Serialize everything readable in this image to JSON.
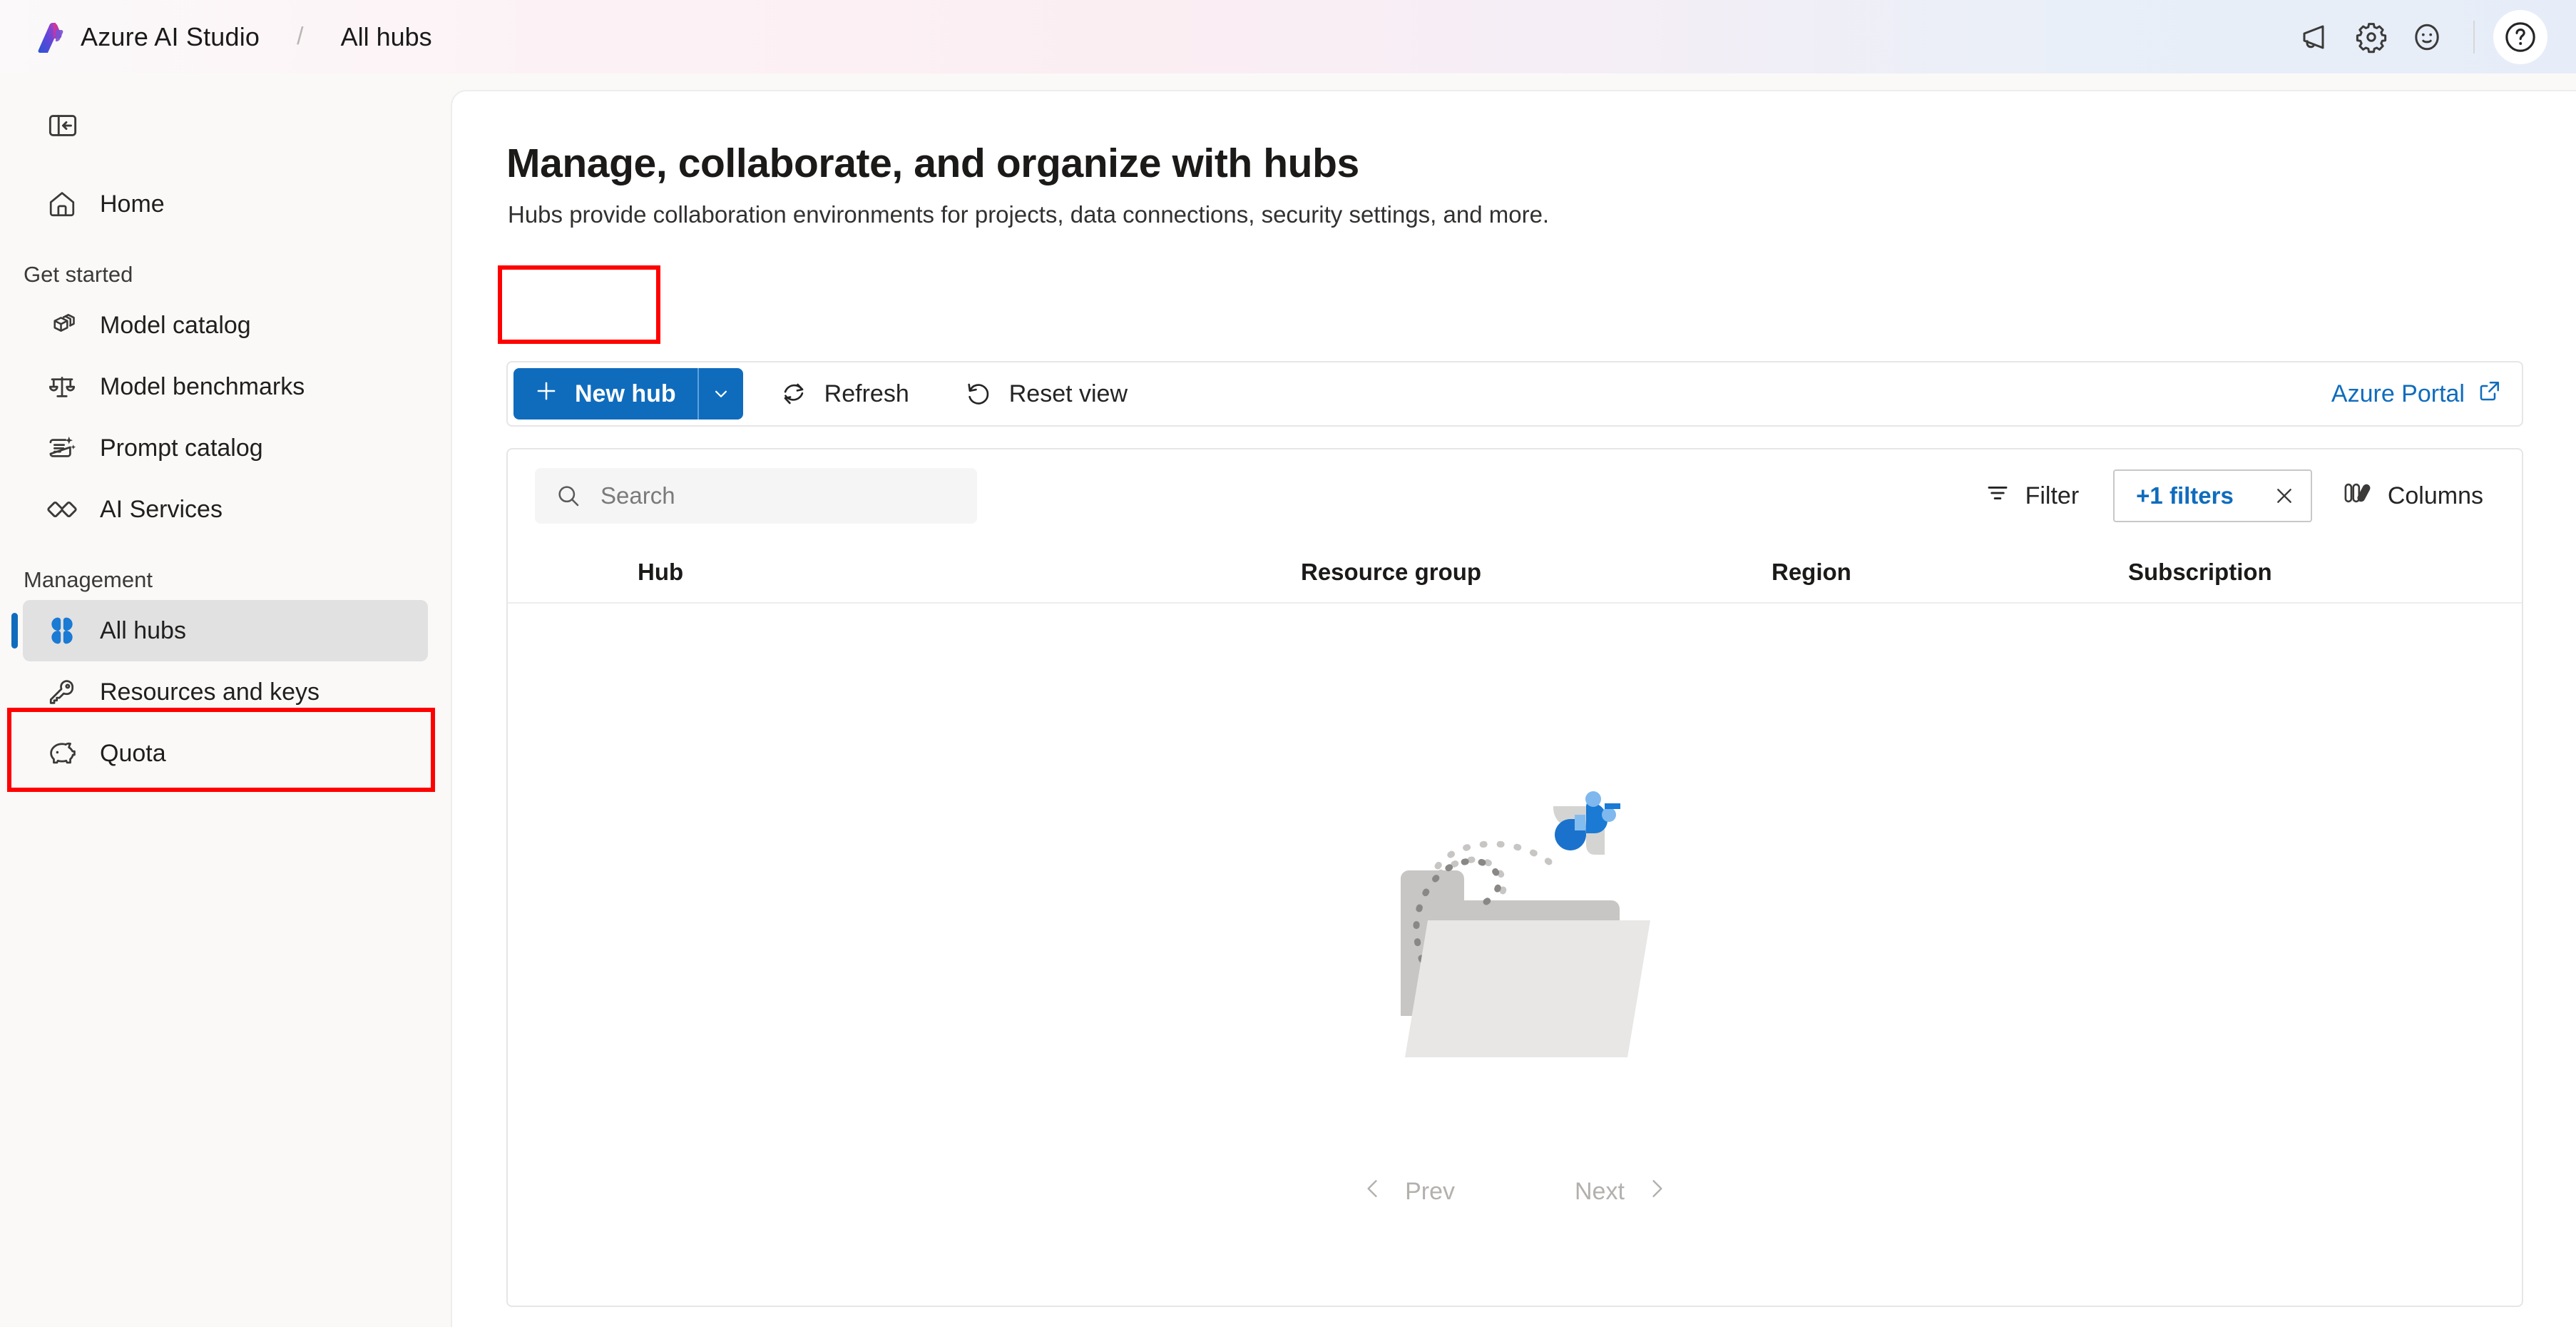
{
  "topbar": {
    "brand": "Azure AI Studio",
    "separator": "/",
    "breadcrumb_current": "All hubs",
    "icons": [
      {
        "name": "announcements-icon",
        "label": "Announcements"
      },
      {
        "name": "settings-gear-icon",
        "label": "Settings"
      },
      {
        "name": "feedback-smiley-icon",
        "label": "Feedback"
      },
      {
        "name": "help-question-icon",
        "label": "Help"
      }
    ]
  },
  "sidebar": {
    "collapse_label": "Collapse navigation",
    "home": {
      "label": "Home",
      "icon": "home-icon"
    },
    "groups": [
      {
        "title": "Get started",
        "items": [
          {
            "label": "Model catalog",
            "icon": "cube-boxes-icon"
          },
          {
            "label": "Model benchmarks",
            "icon": "balance-scales-icon"
          },
          {
            "label": "Prompt catalog",
            "icon": "prompt-sparkle-icon"
          },
          {
            "label": "AI Services",
            "icon": "diamonds-icon"
          }
        ]
      },
      {
        "title": "Management",
        "items": [
          {
            "label": "All hubs",
            "icon": "all-hubs-icon",
            "selected": true
          },
          {
            "label": "Resources and keys",
            "icon": "key-icon"
          },
          {
            "label": "Quota",
            "icon": "piggy-bank-icon"
          }
        ]
      }
    ]
  },
  "main": {
    "title": "Manage, collaborate, and organize with hubs",
    "subtitle": "Hubs provide collaboration environments for projects, data connections, security settings, and more.",
    "toolbar": {
      "new_hub_label": "New hub",
      "new_hub_caret": "chevron-down-icon",
      "refresh_label": "Refresh",
      "reset_view_label": "Reset view",
      "azure_portal_label": "Azure Portal"
    },
    "filters": {
      "search_placeholder": "Search",
      "search_value": "",
      "filter_label": "Filter",
      "active_filters_label": "+1 filters",
      "clear_filters_label": "Clear filters",
      "columns_label": "Columns"
    },
    "table": {
      "columns": [
        "Hub",
        "Resource group",
        "Region",
        "Subscription"
      ],
      "rows": []
    },
    "empty_state": {
      "illustration": "empty-folder-illustration"
    },
    "pagination": {
      "prev_label": "Prev",
      "next_label": "Next"
    }
  },
  "annotations": {
    "colors": {
      "highlight": "#ff0000"
    },
    "boxes": [
      {
        "name": "new-hub-highlight"
      },
      {
        "name": "all-hubs-highlight"
      }
    ]
  },
  "colors": {
    "accent": "#0f6cbd",
    "selected_bg": "#e1e1e1",
    "panel_bg": "#ffffff",
    "shell_bg": "#faf9f8"
  }
}
